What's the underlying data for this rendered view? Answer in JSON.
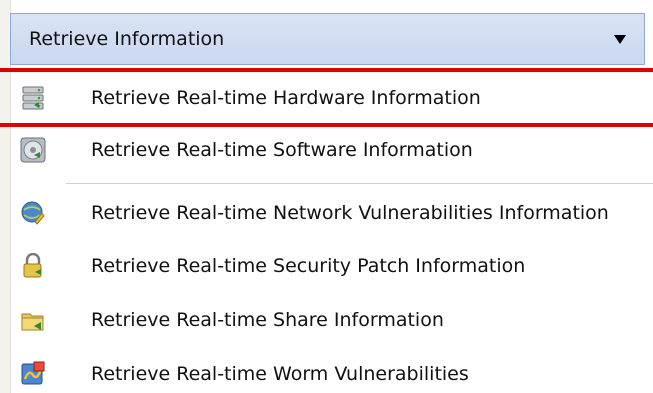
{
  "dropdown": {
    "selected": "Retrieve Information",
    "arrow_icon": "triangle-down-icon"
  },
  "menu": {
    "items": [
      {
        "label": "Retrieve Real-time Hardware Information",
        "icon": "hardware-server-icon"
      },
      {
        "label": "Retrieve Real-time Software Information",
        "icon": "software-disc-icon"
      },
      {
        "label": "Retrieve Real-time Network Vulnerabilities Information",
        "icon": "network-vulnerability-icon"
      },
      {
        "label": "Retrieve Real-time Security Patch Information",
        "icon": "security-patch-lock-icon"
      },
      {
        "label": "Retrieve Real-time Share Information",
        "icon": "shared-folder-icon"
      },
      {
        "label": "Retrieve Real-time Worm Vulnerabilities",
        "icon": "worm-vulnerability-icon"
      }
    ]
  },
  "colors": {
    "highlight_border": "#e00000",
    "dropdown_background": "#d4dff2",
    "dropdown_border": "#8fa9d6"
  }
}
